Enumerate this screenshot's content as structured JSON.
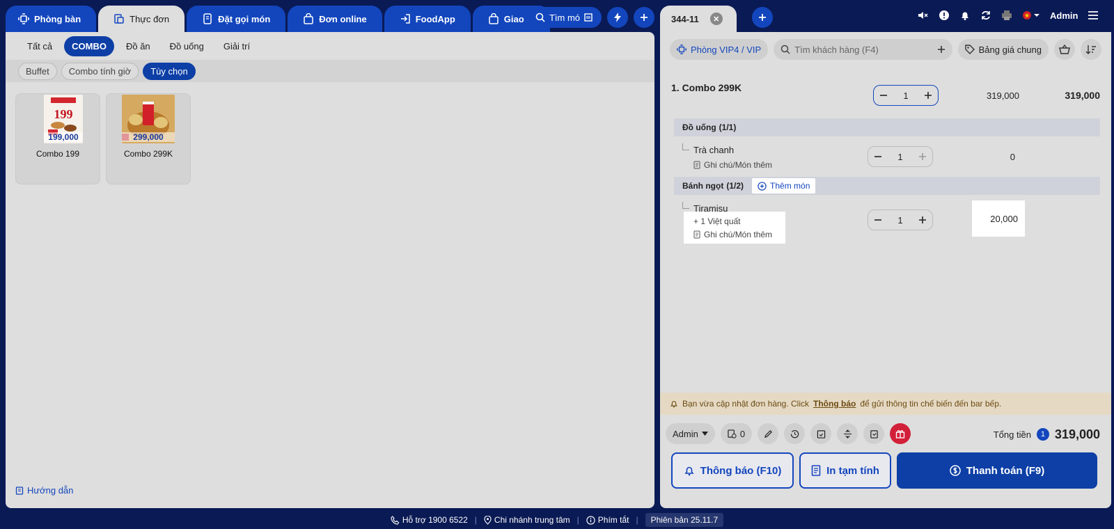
{
  "topnav": {
    "tabs": [
      {
        "label": "Phòng bàn",
        "icon": "table-icon"
      },
      {
        "label": "Thực đơn",
        "icon": "menu-icon"
      },
      {
        "label": "Đặt gọi món",
        "icon": "order-phone-icon"
      },
      {
        "label": "Đơn online",
        "icon": "bag-icon"
      },
      {
        "label": "FoodApp",
        "icon": "login-icon"
      },
      {
        "label": "Giao đi",
        "icon": "bag-icon"
      }
    ],
    "search_label": "Tìm mó"
  },
  "categories": [
    "Tất cả",
    "COMBO",
    "Đồ ăn",
    "Đồ uống",
    "Giải trí"
  ],
  "subcategories": [
    "Buffet",
    "Combo tính giờ",
    "Tùy chọn"
  ],
  "products": [
    {
      "name": "Combo 199",
      "price": "199,000"
    },
    {
      "name": "Combo 299K",
      "price": "299,000"
    }
  ],
  "guide": "Hướng dẫn",
  "order": {
    "tab_label": "344-11",
    "room": "Phòng VIP4 / VIP",
    "customer_placeholder": "Tìm khách hàng (F4)",
    "pricelist": "Bảng giá chung",
    "item": {
      "name": "1. Combo 299K",
      "qty": "1",
      "unit_price": "319,000",
      "line_total": "319,000"
    },
    "group1": {
      "name": "Đồ uống",
      "count": "(1/1)"
    },
    "sub1": {
      "name": "Trà chanh",
      "qty": "1",
      "price": "0",
      "note": "Ghi chú/Món thêm"
    },
    "group2": {
      "name": "Bánh ngọt",
      "count": "(1/2)",
      "add": "Thêm món"
    },
    "sub2": {
      "name": "Tiramisu",
      "qty": "1",
      "price": "20,000",
      "topping": "+ 1 Việt quất",
      "note": "Ghi chú/Món thêm"
    },
    "notice_pre": "Bạn vừa cập nhật đơn hàng. Click",
    "notice_link": "Thông báo",
    "notice_post": "để gửi thông tin chế biến đến bar bếp.",
    "staff": "Admin",
    "waiting_count": "0",
    "total_label": "Tổng tiền",
    "total_badge": "1",
    "total_amount": "319,000",
    "btn_notify": "Thông báo (F10)",
    "btn_print": "In tạm tính",
    "btn_pay": "Thanh toán (F9)"
  },
  "user": {
    "name": "Admin"
  },
  "footer": {
    "support": "Hỗ trợ 1900 6522",
    "branch": "Chi nhánh trung tâm",
    "shortcuts": "Phím tắt",
    "version": "Phiên bản 25.11.7"
  },
  "colors": {
    "primary": "#1346bd",
    "dark_bg": "#0a1a55",
    "panel": "#dedede",
    "danger": "#d3203a"
  }
}
